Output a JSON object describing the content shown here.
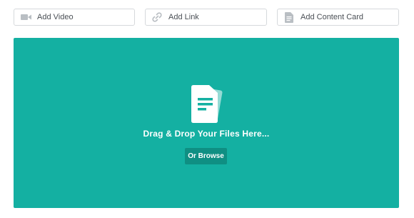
{
  "toolbar": {
    "video": {
      "label": "Add Video",
      "icon": "video-camera-icon"
    },
    "link": {
      "label": "Add Link",
      "icon": "link-icon"
    },
    "card": {
      "label": "Add Content Card",
      "icon": "document-icon"
    }
  },
  "dropzone": {
    "message": "Drag & Drop Your Files Here...",
    "browse_label": "Or Browse",
    "icon": "files-icon",
    "background_color": "#14b0a2",
    "button_color": "#0f8f83"
  }
}
